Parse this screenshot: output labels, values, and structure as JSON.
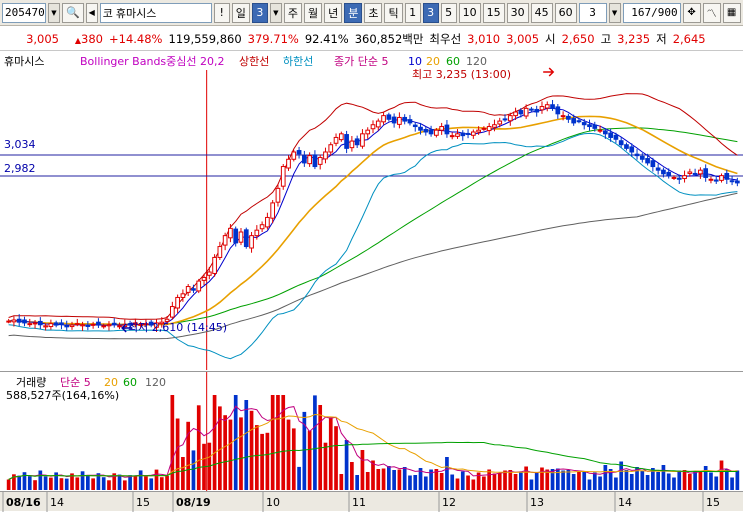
{
  "toolbar": {
    "code": "205470",
    "market": "코",
    "name": "휴마시스",
    "bang": "!",
    "period_day": "일",
    "period_count": "3",
    "week": "주",
    "month": "월",
    "year": "년",
    "minute": "분",
    "second": "초",
    "tick": "틱",
    "intervals": [
      "1",
      "3",
      "5",
      "10",
      "15",
      "30",
      "45",
      "60"
    ],
    "selected_interval": "3",
    "count": "3",
    "range": "167/900"
  },
  "quote": {
    "price": "3,005",
    "change": "380",
    "change_pct": "+14.48%",
    "volume": "119,559,860",
    "volume_ratio": "379.71%",
    "ratio2": "92.41%",
    "amount": "360,852백만",
    "best_ask_label": "최우선",
    "best_ask": "3,010",
    "best_bid": "3,005",
    "open_label": "시",
    "open": "2,650",
    "high_label": "고",
    "high": "3,235",
    "low_label": "저",
    "low": "2,645"
  },
  "price_legend": {
    "name": "휴마시스",
    "bb": "Bollinger Bands중심선 20,2",
    "upper": "상한선",
    "lower": "하한선",
    "ma": "종가 단순 5",
    "ma10": "10",
    "ma20": "20",
    "ma60": "60",
    "ma120": "120"
  },
  "annotations": {
    "high": "최고 3,235 (13:00)",
    "low": "최저 2,610 (14:45)",
    "level1": "3,034",
    "level2": "2,982"
  },
  "volume_legend": {
    "name": "거래량",
    "ma": "단순 5",
    "ma20": "20",
    "ma60": "60",
    "ma120": "120",
    "value": "588,527주(164,16%)"
  },
  "xaxis": [
    "08/16",
    "14",
    "15",
    "08/19",
    "10",
    "11",
    "12",
    "13",
    "14",
    "15"
  ],
  "colors": {
    "up": "#e00000",
    "down": "#0033cc",
    "ma5": "#c00080",
    "ma10": "#0000cc",
    "ma20": "#e8a000",
    "ma60": "#00a000",
    "ma120": "#606060",
    "bb_mid": "#009090",
    "bb_upper": "#c00000",
    "bb_lower": "#0090c0"
  },
  "chart_data": {
    "type": "candlestick",
    "price_levels": [
      3034,
      2982
    ],
    "high_marker": 3235,
    "low_marker": 2610,
    "closes": [
      2625,
      2628,
      2622,
      2620,
      2618,
      2620,
      2615,
      2612,
      2618,
      2614,
      2616,
      2610,
      2614,
      2618,
      2615,
      2612,
      2616,
      2614,
      2612,
      2615,
      2618,
      2612,
      2616,
      2614,
      2620,
      2616,
      2618,
      2614,
      2620,
      2622,
      2630,
      2665,
      2690,
      2700,
      2720,
      2710,
      2735,
      2745,
      2760,
      2800,
      2830,
      2860,
      2880,
      2840,
      2870,
      2830,
      2860,
      2875,
      2890,
      2910,
      2950,
      2990,
      3050,
      3070,
      3090,
      3085,
      3060,
      3080,
      3050,
      3075,
      3090,
      3110,
      3130,
      3140,
      3100,
      3120,
      3110,
      3140,
      3150,
      3165,
      3175,
      3190,
      3180,
      3170,
      3185,
      3175,
      3170,
      3160,
      3150,
      3145,
      3140,
      3150,
      3160,
      3140,
      3135,
      3140,
      3135,
      3140,
      3145,
      3150,
      3155,
      3160,
      3165,
      3175,
      3180,
      3190,
      3200,
      3195,
      3210,
      3205,
      3200,
      3215,
      3220,
      3210,
      3195,
      3190,
      3180,
      3170,
      3175,
      3165,
      3160,
      3155,
      3150,
      3140,
      3130,
      3125,
      3110,
      3100,
      3090,
      3080,
      3070,
      3060,
      3050,
      3040,
      3030,
      3025,
      3020,
      3015,
      3025,
      3035,
      3030,
      3040,
      3020,
      3015,
      3010,
      3025,
      3015,
      3010,
      3005
    ],
    "volume_axis_note": "",
    "x_sessions": [
      "08/16",
      "14",
      "15",
      "08/19",
      "10",
      "11",
      "12",
      "13",
      "14",
      "15"
    ]
  }
}
